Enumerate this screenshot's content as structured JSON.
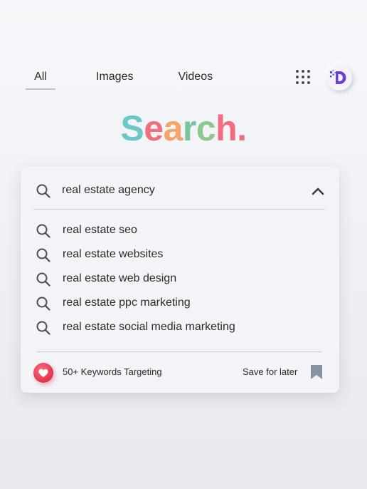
{
  "tabs": [
    {
      "label": "All",
      "active": true
    },
    {
      "label": "Images",
      "active": false
    },
    {
      "label": "Videos",
      "active": false
    }
  ],
  "header": {
    "apps_icon": "grid-dots-icon",
    "logo_icon": "d-pixel-logo",
    "logo_color": "#6b3fd6"
  },
  "brand": {
    "letters": [
      "S",
      "e",
      "a",
      "r",
      "c",
      "h",
      "."
    ],
    "colors": [
      "#6cc7c8",
      "#f26d7e",
      "#f7a468",
      "#7cc4a0",
      "#8dc890",
      "#f26d7e",
      "#f26d7e"
    ]
  },
  "search": {
    "value": "real estate agency",
    "icon": "search-icon",
    "collapse_icon": "chevron-up-icon"
  },
  "suggestions": [
    {
      "label": "real estate seo"
    },
    {
      "label": "real estate websites"
    },
    {
      "label": "real estate web design"
    },
    {
      "label": "real estate ppc marketing"
    },
    {
      "label": "real estate social media marketing"
    }
  ],
  "footer": {
    "keywords_label": "50+ Keywords Targeting",
    "keywords_icon": "heart-icon",
    "save_label": "Save for later",
    "save_icon": "bookmark-icon",
    "heart_color": "#e73a52",
    "bookmark_color": "#8a93a6"
  }
}
